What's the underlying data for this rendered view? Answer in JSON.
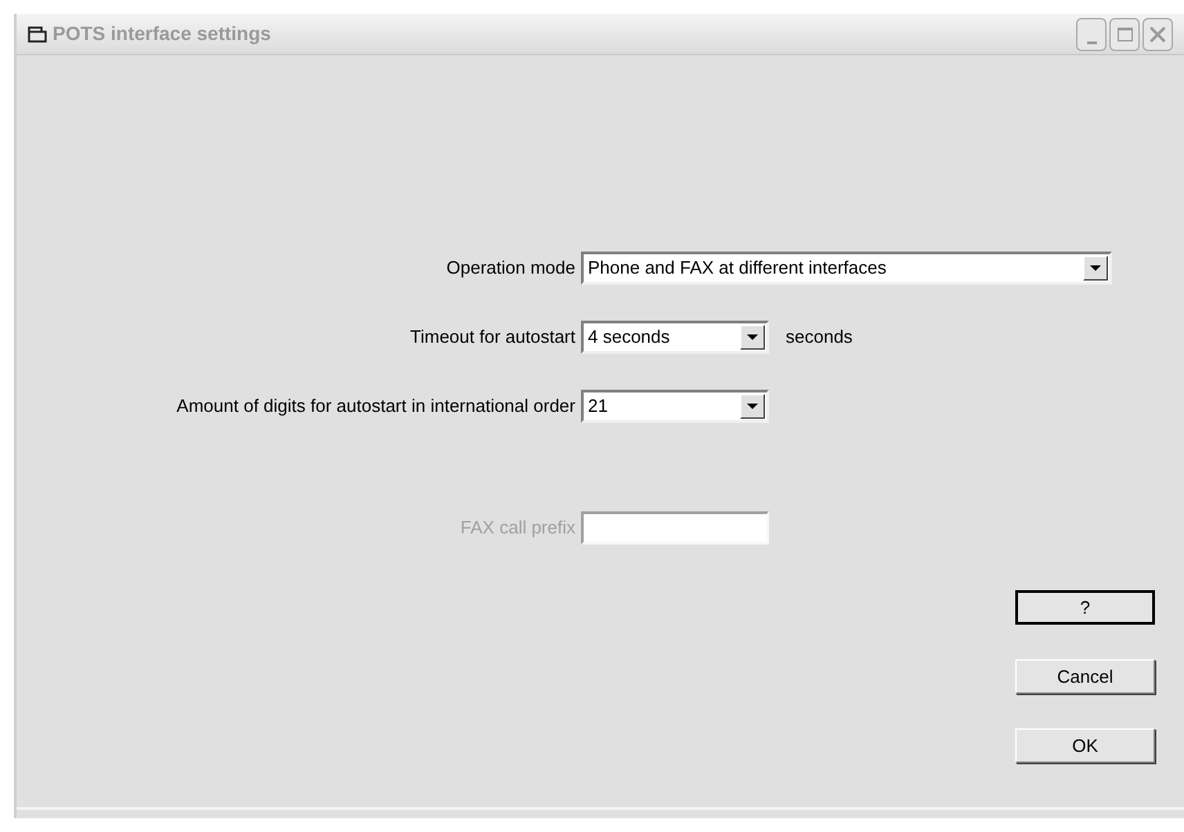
{
  "window": {
    "title": "POTS interface settings"
  },
  "fields": [
    {
      "kind": "combo",
      "label": "Operation mode",
      "value": "Phone and FAX at different interfaces",
      "wide": true,
      "disabled": false
    },
    {
      "kind": "combo",
      "label": "Timeout for autostart",
      "value": "4 seconds",
      "suffix": "seconds",
      "disabled": false
    },
    {
      "kind": "combo",
      "label": "Amount of digits for autostart in international order",
      "value": "21",
      "disabled": false
    },
    {
      "kind": "text",
      "label": "FAX call prefix",
      "disabled": true
    }
  ],
  "buttons": [
    {
      "label": "?",
      "default": true
    },
    {
      "label": "Cancel",
      "default": false
    },
    {
      "label": "OK",
      "default": false
    }
  ]
}
